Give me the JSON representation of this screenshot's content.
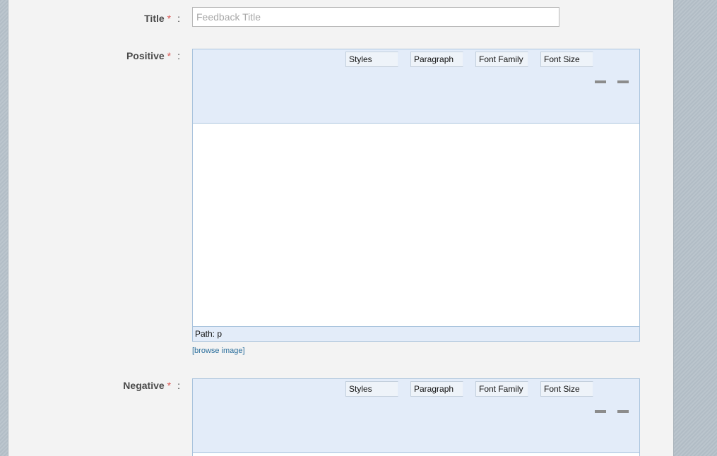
{
  "form": {
    "title": {
      "label": "Title",
      "required_mark": "*",
      "colon": ":",
      "value": "",
      "placeholder": "Feedback Title"
    },
    "positive": {
      "label": "Positive",
      "required_mark": "*",
      "colon": ":",
      "toolbar": {
        "styles": "Styles",
        "paragraph": "Paragraph",
        "font_family": "Font Family",
        "font_size": "Font Size"
      },
      "status_path": "Path: p",
      "browse_link": "[browse image]"
    },
    "negative": {
      "label": "Negative",
      "required_mark": "*",
      "colon": ":",
      "toolbar": {
        "styles": "Styles",
        "paragraph": "Paragraph",
        "font_family": "Font Family",
        "font_size": "Font Size"
      }
    }
  },
  "colors": {
    "panel_background": "#f3f3f3",
    "editor_toolbar": "#e3ecf9",
    "editor_border": "#a9c3dd",
    "required_mark": "#d9534f",
    "link": "#2a6e9c"
  },
  "icons": [
    "minus-icon",
    "minus-icon"
  ]
}
